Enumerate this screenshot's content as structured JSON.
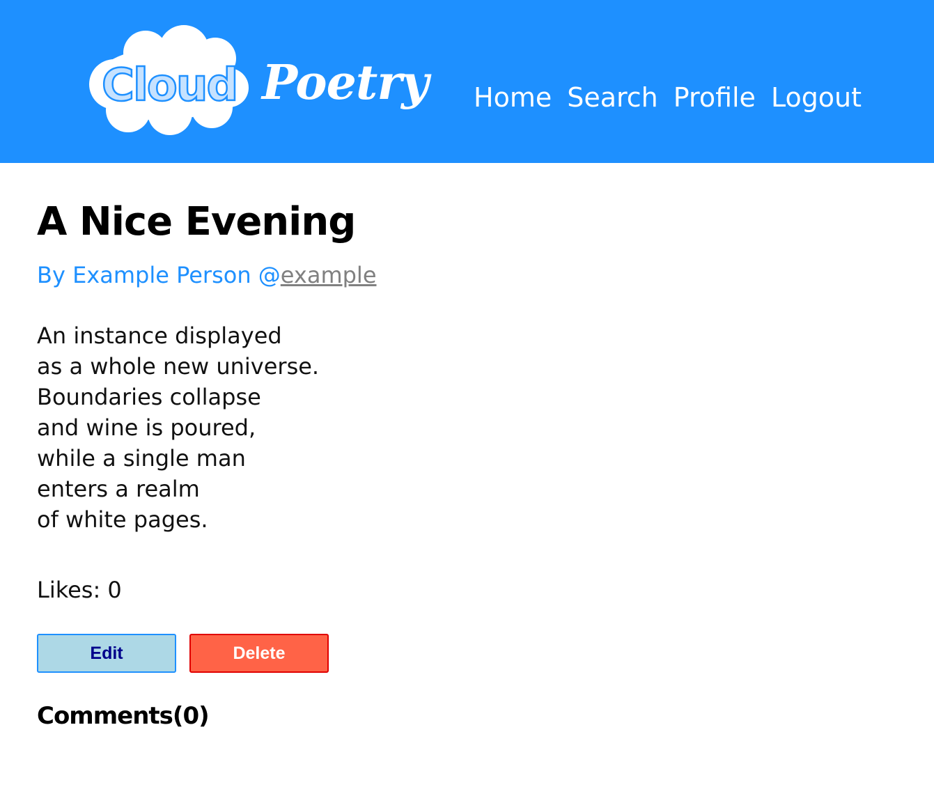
{
  "header": {
    "logo": {
      "text_cloud": "Cloud",
      "text_poetry": "Poetry"
    },
    "nav": {
      "home": "Home",
      "search": "Search",
      "profile": "Profile",
      "logout": "Logout"
    }
  },
  "poem": {
    "title": "A Nice Evening",
    "byline_prefix": "By Example Person @",
    "handle": "example",
    "lines": [
      "An instance displayed",
      "as a whole new universe.",
      "Boundaries collapse",
      "and wine is poured,",
      "while a single man",
      "enters a realm",
      "of white pages."
    ],
    "likes": "Likes: 0"
  },
  "actions": {
    "edit_label": "Edit",
    "delete_label": "Delete"
  },
  "comments": {
    "heading": "Comments(0)"
  },
  "colors": {
    "header_bg": "#1e90ff",
    "byline": "#1e90ff",
    "edit_bg": "#add8e6",
    "edit_text": "#00008b",
    "delete_bg": "#ff6347"
  }
}
